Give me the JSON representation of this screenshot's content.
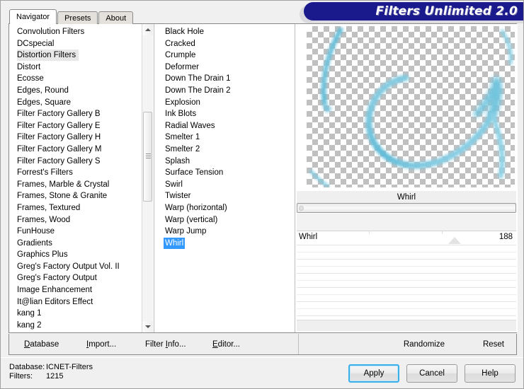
{
  "window": {
    "title": "Filters Unlimited 2.0"
  },
  "tabs": [
    {
      "label": "Navigator",
      "active": true
    },
    {
      "label": "Presets",
      "active": false
    },
    {
      "label": "About",
      "active": false
    }
  ],
  "categories": {
    "selected": "Distortion Filters",
    "items": [
      "Convolution Filters",
      "DCspecial",
      "Distortion Filters",
      "Distort",
      "Ecosse",
      "Edges, Round",
      "Edges, Square",
      "Filter Factory Gallery B",
      "Filter Factory Gallery E",
      "Filter Factory Gallery H",
      "Filter Factory Gallery M",
      "Filter Factory Gallery S",
      "Forrest's Filters",
      "Frames, Marble & Crystal",
      "Frames, Stone & Granite",
      "Frames, Textured",
      "Frames, Wood",
      "FunHouse",
      "Gradients",
      "Graphics Plus",
      "Greg's Factory Output Vol. II",
      "Greg's Factory Output",
      "Image Enhancement",
      "It@lian Editors Effect",
      "kang 1",
      "kang 2"
    ]
  },
  "filters": {
    "selected": "Whirl",
    "items": [
      "Black Hole",
      "Cracked",
      "Crumple",
      "Deformer",
      "Down The Drain 1",
      "Down The Drain 2",
      "Explosion",
      "Ink Blots",
      "Radial Waves",
      "Smelter 1",
      "Smelter 2",
      "Splash",
      "Surface Tension",
      "Swirl",
      "Twister",
      "Warp (horizontal)",
      "Warp (vertical)",
      "Warp Jump",
      "Whirl"
    ]
  },
  "parameters": {
    "header": "Whirl",
    "rows": [
      {
        "name": "Whirl",
        "value": "188",
        "thumb_pct": 72
      },
      {
        "name": "",
        "value": "",
        "thumb_pct": null
      },
      {
        "name": "",
        "value": "",
        "thumb_pct": null
      },
      {
        "name": "",
        "value": "",
        "thumb_pct": null
      },
      {
        "name": "",
        "value": "",
        "thumb_pct": null
      },
      {
        "name": "",
        "value": "",
        "thumb_pct": null
      },
      {
        "name": "",
        "value": "",
        "thumb_pct": null
      }
    ]
  },
  "toolbar": {
    "left": [
      {
        "label": "Database",
        "mnemonic": "D"
      },
      {
        "label": "Import...",
        "mnemonic": "I"
      },
      {
        "label": "Filter Info...",
        "mnemonic": "I"
      },
      {
        "label": "Editor...",
        "mnemonic": "E"
      }
    ],
    "right": [
      {
        "label": "Randomize"
      },
      {
        "label": "Reset"
      }
    ]
  },
  "status": {
    "database_label": "Database:",
    "database_value": "ICNET-Filters",
    "filters_label": "Filters:",
    "filters_value": "1215"
  },
  "buttons": [
    {
      "label": "Apply",
      "default": true
    },
    {
      "label": "Cancel",
      "default": false
    },
    {
      "label": "Help",
      "default": false
    }
  ],
  "colors": {
    "banner": "#1a1a8c",
    "selection": "#3399ff",
    "default_button_border": "#3daee9",
    "preview_stroke": "#6ec3de"
  }
}
